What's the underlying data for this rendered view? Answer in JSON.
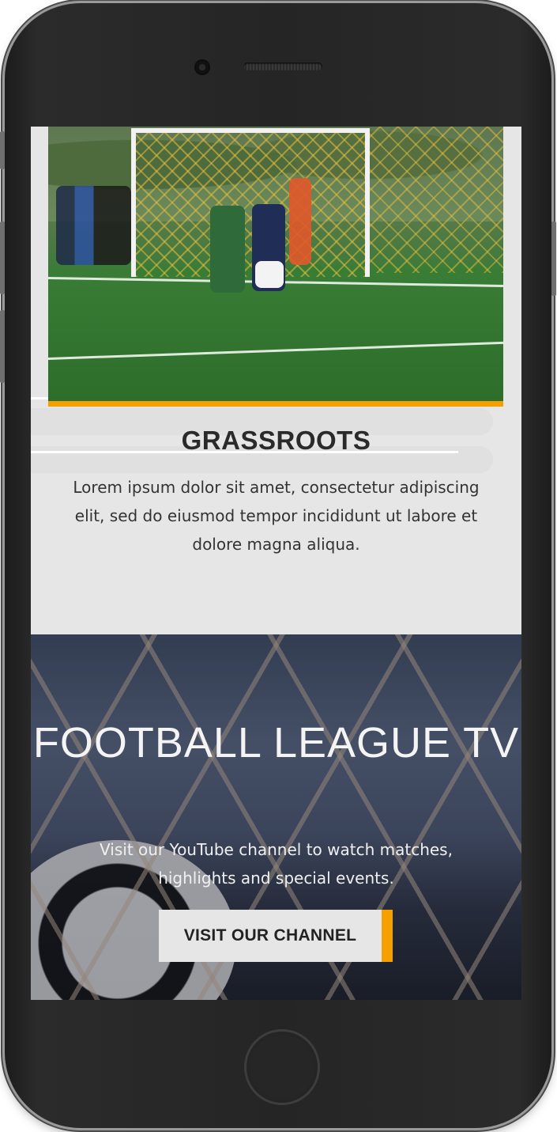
{
  "grassroots": {
    "title": "GRASSROOTS",
    "body": "Lorem ipsum dolor sit amet, consectetur adipiscing elit, sed do eiusmod tempor incididunt ut labore et dolore magna aliqua."
  },
  "league_tv": {
    "title": "FOOTBALL LEAGUE TV",
    "description": "Visit our YouTube channel to watch matches, highlights and special events.",
    "cta_label": "VISIT OUR CHANNEL"
  },
  "colors": {
    "accent": "#f6a000",
    "section_bg": "#e6e6e6",
    "text_dark": "#2a2a2a"
  }
}
